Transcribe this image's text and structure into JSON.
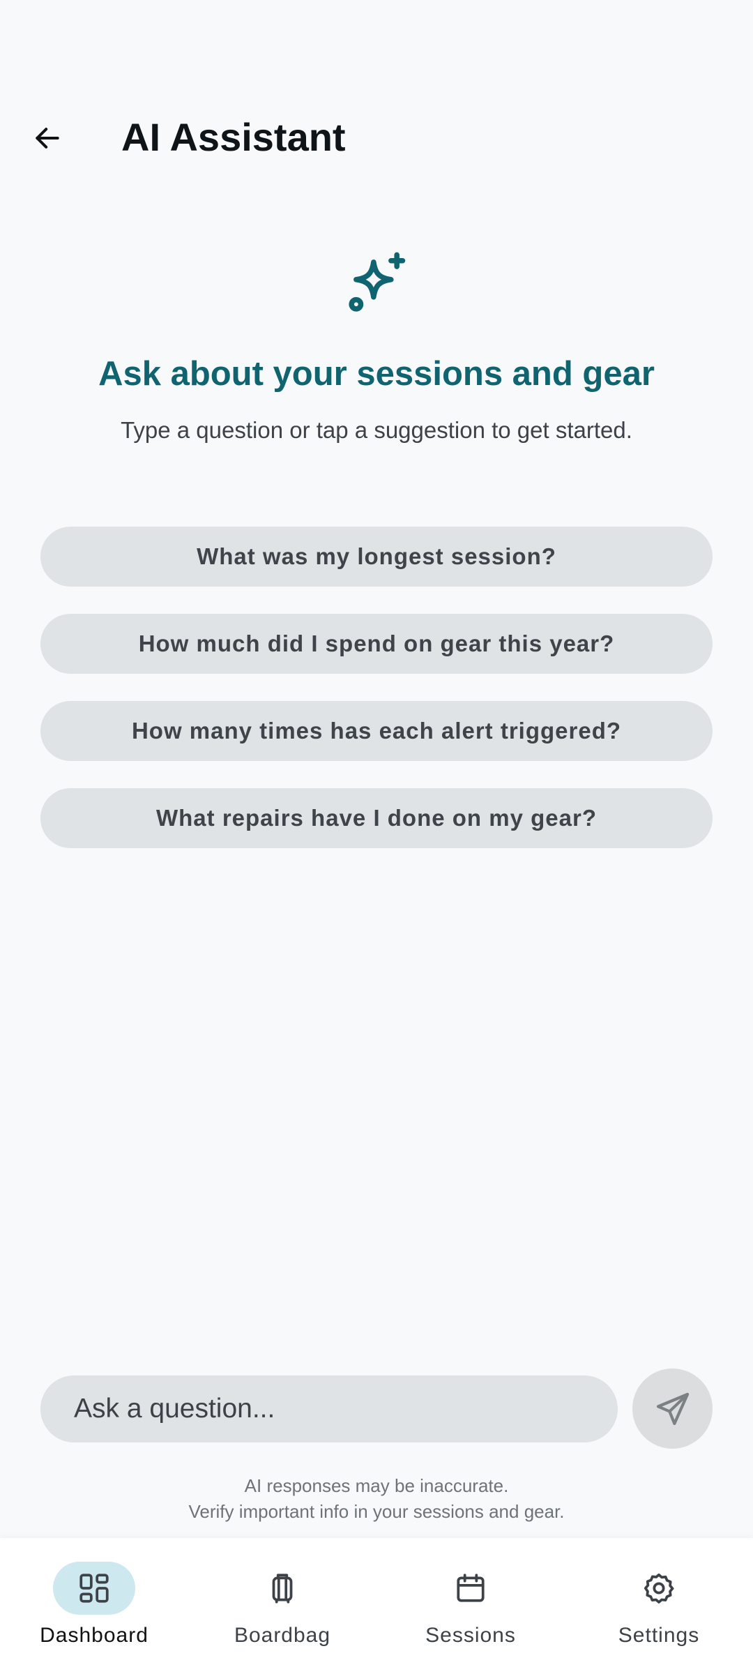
{
  "header": {
    "title": "AI Assistant"
  },
  "hero": {
    "icon": "sparkle-icon",
    "title": "Ask about your sessions and gear",
    "subtitle": "Type a question or tap a suggestion to get started."
  },
  "suggestions": [
    {
      "label": "What was my longest session?"
    },
    {
      "label": "How much did I spend on gear this year?"
    },
    {
      "label": "How many times has each alert triggered?"
    },
    {
      "label": "What repairs have I done on my gear?"
    }
  ],
  "composer": {
    "placeholder": "Ask a question...",
    "value": ""
  },
  "disclaimer": {
    "line1": "AI responses may be inaccurate.",
    "line2": "Verify important info in your sessions and gear."
  },
  "nav": [
    {
      "label": "Dashboard",
      "icon": "dashboard-icon",
      "active": true
    },
    {
      "label": "Boardbag",
      "icon": "luggage-icon",
      "active": false
    },
    {
      "label": "Sessions",
      "icon": "calendar-icon",
      "active": false
    },
    {
      "label": "Settings",
      "icon": "gear-icon",
      "active": false
    }
  ],
  "colors": {
    "accent": "#10646f",
    "chip": "#dfe3e6",
    "nav_active_pill": "#cde8ef",
    "background": "#f7f9fb"
  }
}
